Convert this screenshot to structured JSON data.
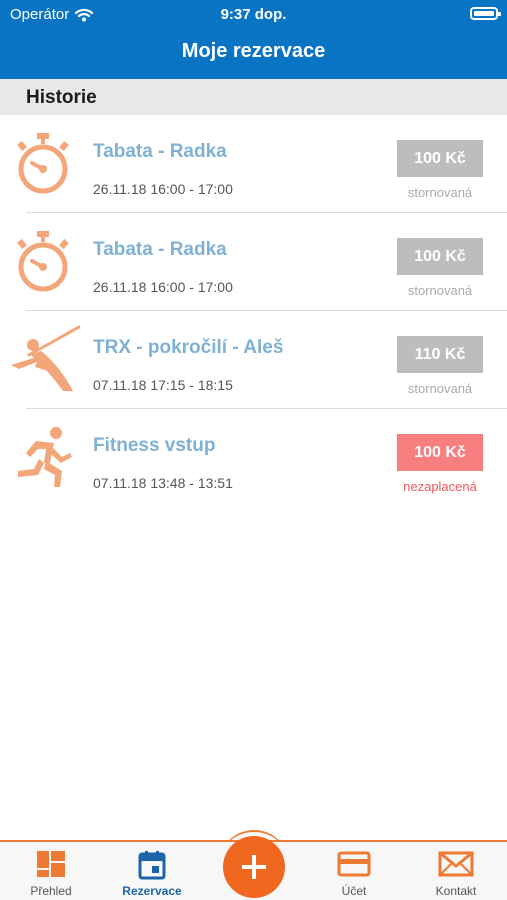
{
  "status": {
    "carrier": "Operátor",
    "time": "9:37 dop."
  },
  "header": {
    "title": "Moje rezervace"
  },
  "section": {
    "title": "Historie"
  },
  "reservations": [
    {
      "icon": "stopwatch-icon",
      "name": "Tabata - Radka",
      "time": "26.11.18 16:00 - 17:00",
      "price": "100 Kč",
      "status": "stornovaná"
    },
    {
      "icon": "stopwatch-icon",
      "name": "Tabata - Radka",
      "time": "26.11.18 16:00 - 17:00",
      "price": "100 Kč",
      "status": "stornovaná"
    },
    {
      "icon": "trx-strap-icon",
      "name": "TRX - pokročilí - Aleš",
      "time": "07.11.18 17:15 - 18:15",
      "price": "110 Kč",
      "status": "stornovaná"
    },
    {
      "icon": "running-man-icon",
      "name": "Fitness vstup",
      "time": "07.11.18 13:48 - 13:51",
      "price": "100 Kč",
      "status": "nezaplacená"
    }
  ],
  "tabs": [
    {
      "label": "Přehled",
      "icon": "dashboard-icon"
    },
    {
      "label": "Rezervace",
      "icon": "calendar-icon"
    },
    {
      "label": "Účet",
      "icon": "credit-card-icon"
    },
    {
      "label": "Kontakt",
      "icon": "envelope-icon"
    }
  ],
  "fab": {
    "icon": "plus-icon"
  },
  "colors": {
    "header": "#0a74c4",
    "accent": "#ee7a34",
    "icon": "#f3a67a",
    "name": "#7fb1d4",
    "unpaid": "#f77f7f",
    "active_tab": "#1d63a8"
  }
}
